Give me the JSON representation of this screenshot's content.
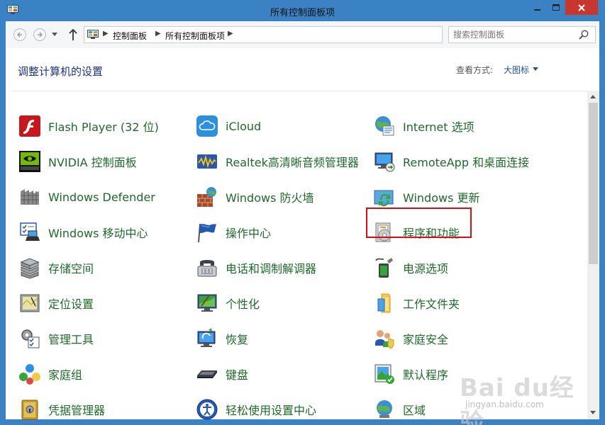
{
  "window": {
    "title": "所有控制面板项"
  },
  "address": {
    "crumbs": [
      "控制面板",
      "所有控制面板项"
    ],
    "search_placeholder": "搜索控制面板"
  },
  "header": {
    "title": "调整计算机的设置",
    "view_label": "查看方式:",
    "view_value": "大图标"
  },
  "colors": {
    "title_bar": "#3a82c4",
    "close_button": "#c7372f",
    "item_text": "#1e6a2a",
    "header_text": "#1e3287",
    "highlight_border": "#d60f16"
  },
  "items": [
    {
      "label": "Flash Player (32 位)",
      "icon": "flash-player-icon"
    },
    {
      "label": "iCloud",
      "icon": "icloud-icon"
    },
    {
      "label": "Internet 选项",
      "icon": "internet-options-icon"
    },
    {
      "label": "NVIDIA 控制面板",
      "icon": "nvidia-icon"
    },
    {
      "label": "Realtek高清晰音频管理器",
      "icon": "realtek-audio-icon"
    },
    {
      "label": "RemoteApp 和桌面连接",
      "icon": "remoteapp-icon"
    },
    {
      "label": "Windows Defender",
      "icon": "defender-icon"
    },
    {
      "label": "Windows 防火墙",
      "icon": "firewall-icon"
    },
    {
      "label": "Windows 更新",
      "icon": "windows-update-icon"
    },
    {
      "label": "Windows 移动中心",
      "icon": "mobility-center-icon"
    },
    {
      "label": "操作中心",
      "icon": "action-center-flag-icon"
    },
    {
      "label": "程序和功能",
      "icon": "programs-features-icon",
      "highlighted": true
    },
    {
      "label": "存储空间",
      "icon": "storage-spaces-icon"
    },
    {
      "label": "电话和调制解调器",
      "icon": "phone-modem-icon"
    },
    {
      "label": "电源选项",
      "icon": "power-options-icon"
    },
    {
      "label": "定位设置",
      "icon": "location-settings-icon"
    },
    {
      "label": "个性化",
      "icon": "personalization-icon"
    },
    {
      "label": "工作文件夹",
      "icon": "work-folders-icon"
    },
    {
      "label": "管理工具",
      "icon": "admin-tools-icon"
    },
    {
      "label": "恢复",
      "icon": "recovery-icon"
    },
    {
      "label": "家庭安全",
      "icon": "family-safety-icon"
    },
    {
      "label": "家庭组",
      "icon": "homegroup-icon"
    },
    {
      "label": "键盘",
      "icon": "keyboard-icon"
    },
    {
      "label": "默认程序",
      "icon": "default-programs-icon"
    },
    {
      "label": "凭据管理器",
      "icon": "credential-manager-icon"
    },
    {
      "label": "轻松使用设置中心",
      "icon": "ease-of-access-icon"
    },
    {
      "label": "区域",
      "icon": "region-icon"
    }
  ],
  "watermark": {
    "main": "Bai du经验",
    "sub": "jingyan.baidu.com"
  }
}
